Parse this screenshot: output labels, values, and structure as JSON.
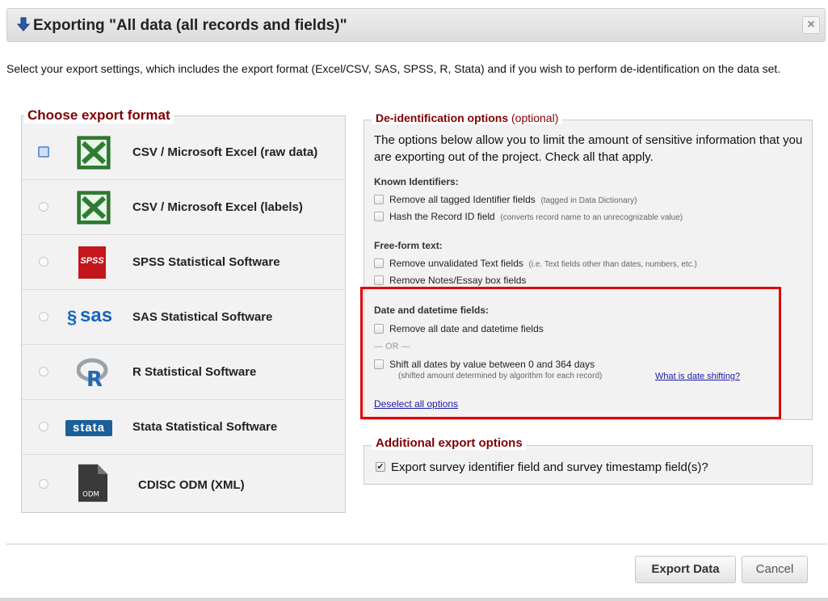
{
  "dialog": {
    "title": "Exporting \"All data (all records and fields)\"",
    "close_label": "×",
    "intro": "Select your export settings, which includes the export format (Excel/CSV, SAS, SPSS, R, Stata) and if you wish to perform de-identification on the data set."
  },
  "formats": {
    "legend": "Choose export format",
    "items": [
      {
        "label": "CSV / Microsoft Excel (raw data)",
        "icon": "excel-icon",
        "selected": true
      },
      {
        "label": "CSV / Microsoft Excel (labels)",
        "icon": "excel-icon",
        "selected": false
      },
      {
        "label": "SPSS Statistical Software",
        "icon": "spss-icon",
        "logo_text": "SPSS",
        "selected": false
      },
      {
        "label": "SAS Statistical Software",
        "icon": "sas-icon",
        "logo_text": "sas",
        "selected": false
      },
      {
        "label": "R Statistical Software",
        "icon": "r-icon",
        "logo_text": "R",
        "selected": false
      },
      {
        "label": "Stata Statistical Software",
        "icon": "stata-icon",
        "logo_text": "stata",
        "selected": false
      },
      {
        "label": "CDISC ODM (XML)",
        "icon": "odm-file-icon",
        "logo_text": "ODM",
        "selected": false
      }
    ]
  },
  "deid": {
    "legend_bold": "De-identification options",
    "legend_suffix": " (optional)",
    "intro": "The options below allow you to limit the amount of sensitive information that you are exporting out of the project. Check all that apply.",
    "known_identifiers": {
      "heading": "Known Identifiers:",
      "opt1": "Remove all tagged Identifier fields",
      "opt1_note": "(tagged in Data Dictionary)",
      "opt2": "Hash the Record ID field",
      "opt2_note": "(converts record name to an unrecognizable value)"
    },
    "free_form": {
      "heading": "Free-form text:",
      "opt1": "Remove unvalidated Text fields",
      "opt1_note": "(i.e. Text fields other than dates, numbers, etc.)",
      "opt2": "Remove Notes/Essay box fields"
    },
    "dates": {
      "heading": "Date and datetime fields:",
      "opt1": "Remove all date and datetime fields",
      "or_text": "— OR —",
      "opt2": "Shift all dates by value between 0 and 364 days",
      "opt2_sub": "(shifted amount determined by algorithm for each record)",
      "link": "What is date shifting?"
    },
    "deselect": "Deselect all options"
  },
  "additional": {
    "legend": "Additional export options",
    "checkmark": "✔",
    "label": "Export survey identifier field and survey timestamp field(s)?",
    "checked": true
  },
  "buttons": {
    "export": "Export Data",
    "cancel": "Cancel"
  },
  "colors": {
    "legend": "#800000",
    "highlight": "#e00000",
    "link": "#1a1aa6"
  }
}
